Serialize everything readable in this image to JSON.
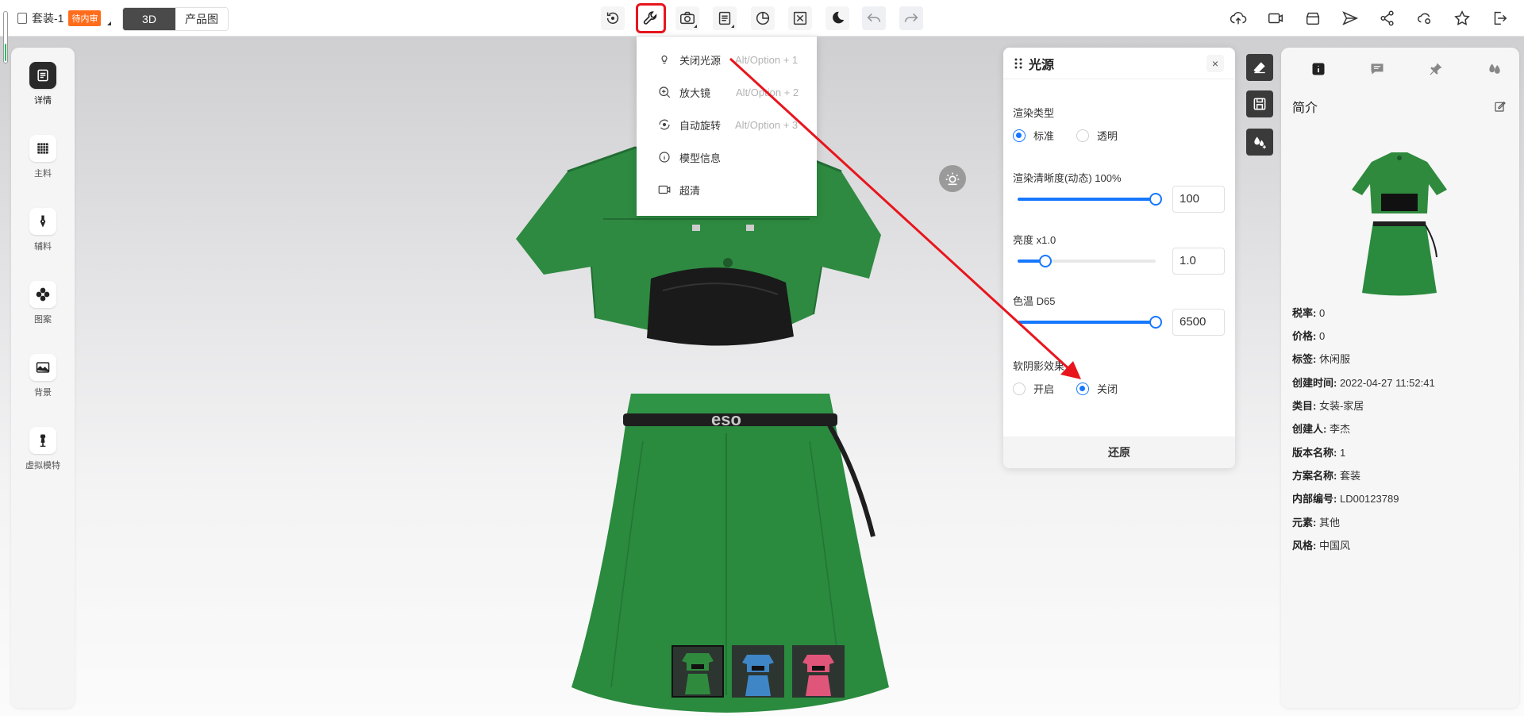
{
  "header": {
    "doc_title": "套装-1",
    "status_badge": "待内审",
    "view_tabs": [
      "3D",
      "产品图"
    ],
    "active_view": "3D"
  },
  "toolbar": {
    "center_icons": [
      "reset-view-icon",
      "wrench-icon",
      "camera-icon",
      "document-icon",
      "pie-chart-icon",
      "fullscreen-icon",
      "moon-icon",
      "undo-icon",
      "redo-icon"
    ],
    "right_icons": [
      "cloud-upload-icon",
      "video-icon",
      "scan-icon",
      "send-icon",
      "share-icon",
      "cloud-settings-icon",
      "star-icon",
      "exit-icon"
    ]
  },
  "sidebar": {
    "items": [
      {
        "label": "详情",
        "icon": "detail-icon"
      },
      {
        "label": "主料",
        "icon": "grid-fabric-icon"
      },
      {
        "label": "辅料",
        "icon": "zipper-icon"
      },
      {
        "label": "图案",
        "icon": "pattern-icon"
      },
      {
        "label": "背景",
        "icon": "image-icon"
      },
      {
        "label": "虚拟模特",
        "icon": "mannequin-icon"
      }
    ]
  },
  "dropdown": {
    "items": [
      {
        "label": "关闭光源",
        "shortcut": "Alt/Option + 1",
        "icon": "bulb-icon"
      },
      {
        "label": "放大镜",
        "shortcut": "Alt/Option + 2",
        "icon": "zoom-in-icon"
      },
      {
        "label": "自动旋转",
        "shortcut": "Alt/Option + 3",
        "icon": "rotate-icon"
      },
      {
        "label": "模型信息",
        "shortcut": "",
        "icon": "info-icon"
      },
      {
        "label": "超清",
        "shortcut": "",
        "icon": "hd-camera-icon"
      }
    ]
  },
  "light_panel": {
    "title": "光源",
    "render_type_label": "渲染类型",
    "render_type_options": [
      "标准",
      "透明"
    ],
    "render_type_selected": "标准",
    "clarity_label": "渲染清晰度(动态) 100%",
    "clarity_value": "100",
    "clarity_fraction": 1.0,
    "brightness_label": "亮度 x1.0",
    "brightness_value": "1.0",
    "brightness_fraction": 0.2,
    "color_temp_label": "色温 D65",
    "color_temp_value": "6500",
    "color_temp_fraction": 1.0,
    "soft_shadow_label": "软阴影效果",
    "soft_shadow_options": [
      "开启",
      "关闭"
    ],
    "soft_shadow_selected": "关闭",
    "reset_label": "还原"
  },
  "info_panel": {
    "title": "简介",
    "fields": [
      {
        "key": "税率:",
        "value": "0"
      },
      {
        "key": "价格:",
        "value": "0"
      },
      {
        "key": "标签:",
        "value": "休闲服"
      },
      {
        "key": "创建时间:",
        "value": "2022-04-27 11:52:41"
      },
      {
        "key": "类目:",
        "value": "女装-家居"
      },
      {
        "key": "创建人:",
        "value": "李杰"
      },
      {
        "key": "版本名称:",
        "value": "1"
      },
      {
        "key": "方案名称:",
        "value": "套装"
      },
      {
        "key": "内部编号:",
        "value": "LD00123789"
      },
      {
        "key": "元素:",
        "value": "其他"
      },
      {
        "key": "风格:",
        "value": "中国风"
      }
    ]
  },
  "variants": [
    {
      "color": "#2f8a3e",
      "selected": true
    },
    {
      "color": "#3f86c6",
      "selected": false
    },
    {
      "color": "#e0567a",
      "selected": false
    }
  ],
  "colors": {
    "accent": "#1677ff",
    "highlight_border": "#e8151d",
    "badge": "#ff6d1c",
    "garment": "#2b8a3f"
  }
}
